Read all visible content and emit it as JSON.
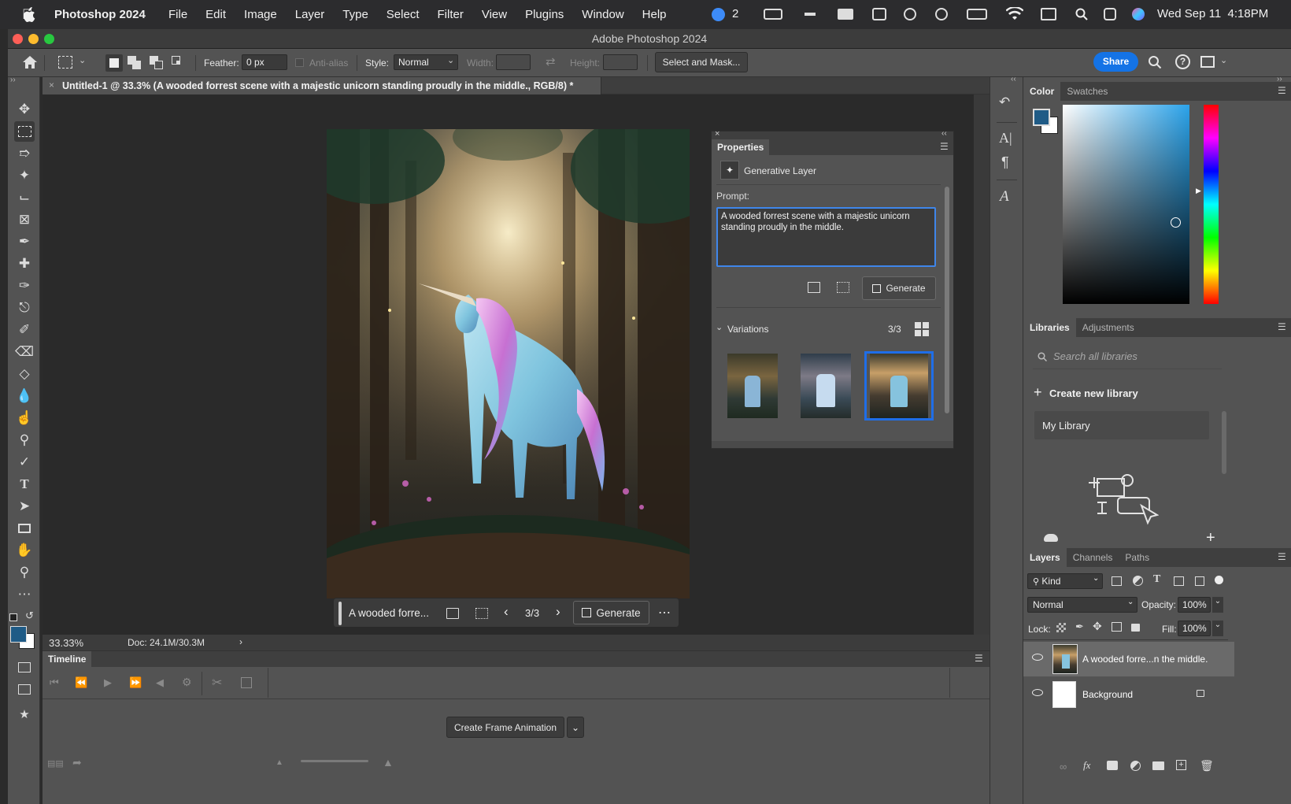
{
  "menubar": {
    "app": "Photoshop 2024",
    "items": [
      "File",
      "Edit",
      "Image",
      "Layer",
      "Type",
      "Select",
      "Filter",
      "View",
      "Plugins",
      "Window",
      "Help"
    ],
    "notif_count": "2",
    "clock": "Wed Sep 11  4:18PM"
  },
  "window": {
    "title": "Adobe Photoshop 2024"
  },
  "options": {
    "feather_label": "Feather:",
    "feather_value": "0 px",
    "antialias_label": "Anti-alias",
    "style_label": "Style:",
    "style_value": "Normal",
    "width_label": "Width:",
    "height_label": "Height:",
    "select_mask": "Select and Mask...",
    "share": "Share"
  },
  "document": {
    "tab_title": "Untitled-1 @ 33.3% (A wooded forrest scene with a majestic unicorn standing proudly in the middle., RGB/8) *",
    "zoom": "33.33%",
    "doc_size": "Doc: 24.1M/30.3M"
  },
  "contextbar": {
    "prompt_short": "A wooded forre...",
    "counter": "3/3",
    "generate": "Generate"
  },
  "properties": {
    "title": "Properties",
    "layer_type": "Generative Layer",
    "prompt_label": "Prompt:",
    "prompt_text": "A wooded forrest scene with a majestic unicorn standing proudly in the middle.",
    "generate": "Generate",
    "variations_label": "Variations",
    "variations_count": "3/3",
    "selected_variation": 3
  },
  "timeline": {
    "title": "Timeline",
    "create_button": "Create Frame Animation"
  },
  "color_panel": {
    "tabs": [
      "Color",
      "Swatches"
    ],
    "foreground": "#1f5b86",
    "background": "#ffffff"
  },
  "libraries_panel": {
    "tabs": [
      "Libraries",
      "Adjustments"
    ],
    "search_placeholder": "Search all libraries",
    "create_new": "Create new library",
    "library_name": "My Library"
  },
  "layers_panel": {
    "tabs": [
      "Layers",
      "Channels",
      "Paths"
    ],
    "filter_kind": "Kind",
    "blend_mode": "Normal",
    "opacity_label": "Opacity:",
    "opacity_value": "100%",
    "lock_label": "Lock:",
    "fill_label": "Fill:",
    "fill_value": "100%",
    "layers": [
      {
        "name": "A wooded forre...n the middle.",
        "selected": true
      },
      {
        "name": "Background",
        "locked": true
      }
    ]
  }
}
